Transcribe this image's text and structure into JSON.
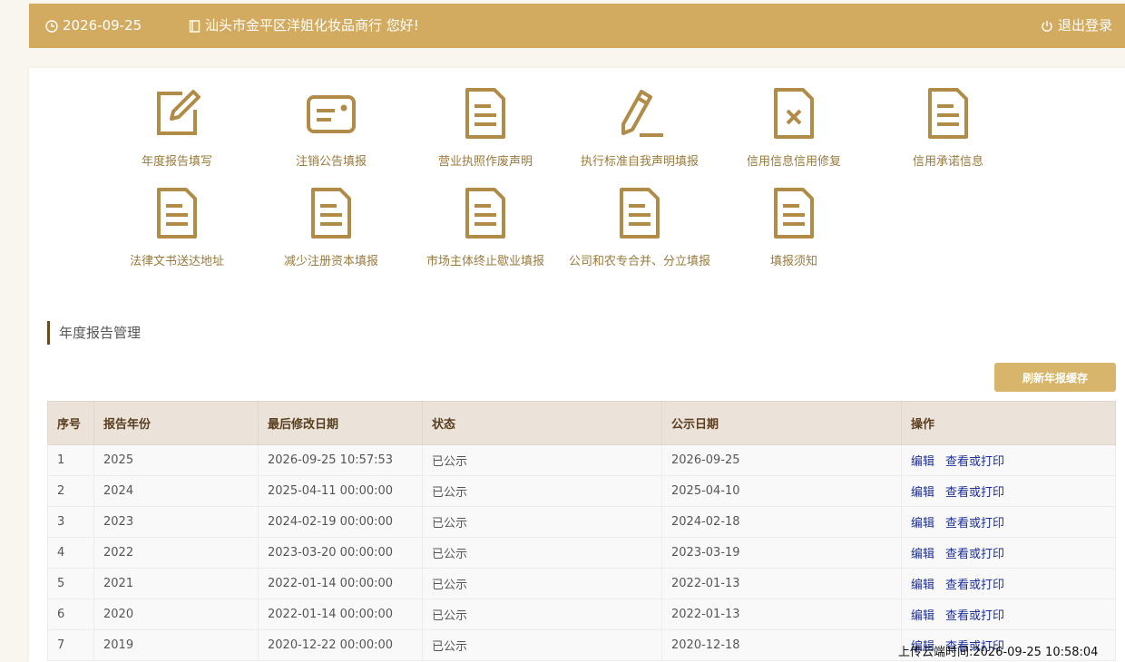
{
  "header": {
    "date": "2026-09-25",
    "greeting": "汕头市金平区洋姐化妆品商行 您好!",
    "logout_label": "退出登录"
  },
  "tiles": [
    {
      "label": "年度报告填写",
      "icon": "edit-icon"
    },
    {
      "label": "注销公告填报",
      "icon": "card-icon"
    },
    {
      "label": "营业执照作废声明",
      "icon": "document-icon"
    },
    {
      "label": "执行标准自我声明填报",
      "icon": "pencil-icon"
    },
    {
      "label": "信用信息信用修复",
      "icon": "document-x-icon"
    },
    {
      "label": "信用承诺信息",
      "icon": "document-icon"
    },
    {
      "label": "法律文书送达地址",
      "icon": "document-icon"
    },
    {
      "label": "减少注册资本填报",
      "icon": "document-icon"
    },
    {
      "label": "市场主体终止歇业填报",
      "icon": "document-icon"
    },
    {
      "label": "公司和农专合并、分立填报",
      "icon": "document-icon"
    },
    {
      "label": "填报须知",
      "icon": "document-icon"
    }
  ],
  "section": {
    "title": "年度报告管理",
    "refresh_label": "刷新年报缓存"
  },
  "table": {
    "columns": [
      "序号",
      "报告年份",
      "最后修改日期",
      "状态",
      "公示日期",
      "操作"
    ],
    "rows": [
      {
        "no": "1",
        "year": "2025",
        "modified": "2026-09-25 10:57:53",
        "status": "已公示",
        "publish": "2026-09-25",
        "edit": "编辑",
        "view": "查看或打印"
      },
      {
        "no": "2",
        "year": "2024",
        "modified": "2025-04-11 00:00:00",
        "status": "已公示",
        "publish": "2025-04-10",
        "edit": "编辑",
        "view": "查看或打印"
      },
      {
        "no": "3",
        "year": "2023",
        "modified": "2024-02-19 00:00:00",
        "status": "已公示",
        "publish": "2024-02-18",
        "edit": "编辑",
        "view": "查看或打印"
      },
      {
        "no": "4",
        "year": "2022",
        "modified": "2023-03-20 00:00:00",
        "status": "已公示",
        "publish": "2023-03-19",
        "edit": "编辑",
        "view": "查看或打印"
      },
      {
        "no": "5",
        "year": "2021",
        "modified": "2022-01-14 00:00:00",
        "status": "已公示",
        "publish": "2022-01-13",
        "edit": "编辑",
        "view": "查看或打印"
      },
      {
        "no": "6",
        "year": "2020",
        "modified": "2022-01-14 00:00:00",
        "status": "已公示",
        "publish": "2022-01-13",
        "edit": "编辑",
        "view": "查看或打印"
      },
      {
        "no": "7",
        "year": "2019",
        "modified": "2020-12-22 00:00:00",
        "status": "已公示",
        "publish": "2020-12-18",
        "edit": "编辑",
        "view": "查看或打印"
      }
    ]
  },
  "upload_time": "上传云端时间:2026-09-25 10:58:04",
  "colors": {
    "header_bg": "#d2ab60",
    "accent": "#b08c48",
    "button": "#d7b56a",
    "link": "#1d2f9a"
  }
}
